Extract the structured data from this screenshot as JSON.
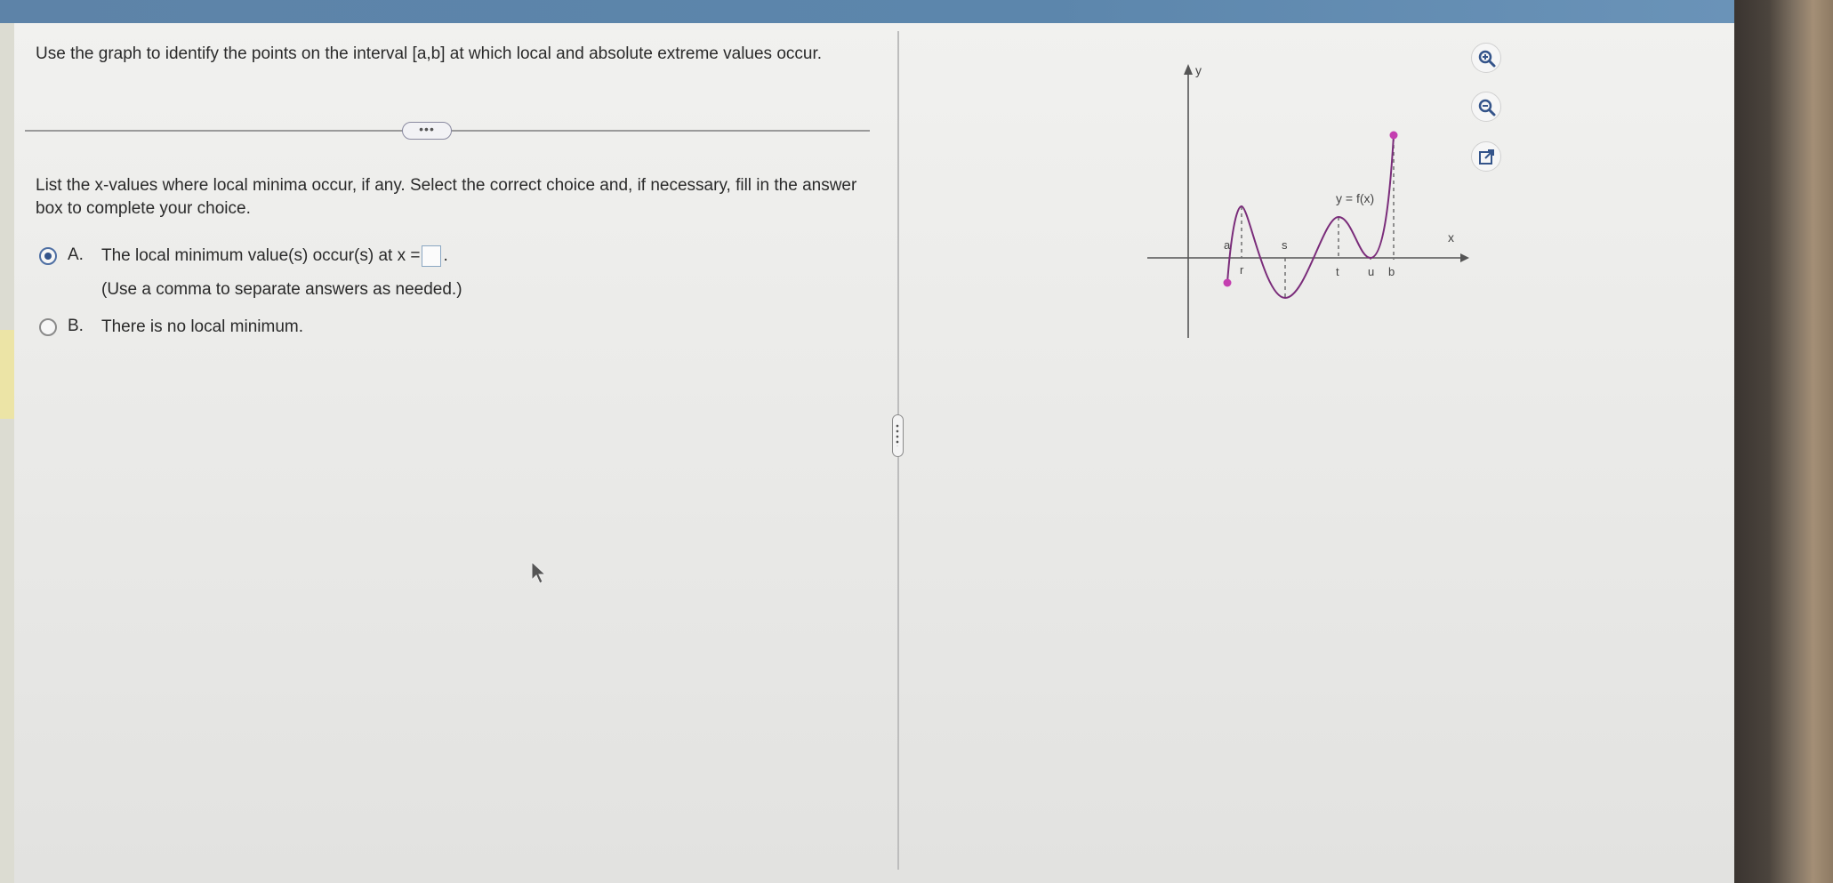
{
  "question": {
    "text": "Use the graph to identify the points on the interval [a,b] at which local and absolute extreme values occur.",
    "more_button": "•••"
  },
  "prompt": "List the x-values where local minima occur, if any. Select the correct choice and, if necessary, fill in the answer box to complete your choice.",
  "choices": [
    {
      "letter": "A.",
      "text_before": "The local minimum value(s) occur(s) at x =",
      "text_after": ".",
      "hint": "(Use a comma to separate answers as needed.)",
      "selected": true,
      "answer_value": ""
    },
    {
      "letter": "B.",
      "text": "There is no local minimum.",
      "selected": false
    }
  ],
  "graph": {
    "curve_label": "y = f(x)",
    "y_axis_label": "y",
    "x_axis_label": "x",
    "x_points": [
      "a",
      "r",
      "s",
      "t",
      "u",
      "b"
    ],
    "curve_color": "#7a2c7a",
    "endpoint_color": "#c43fb0"
  },
  "toolbar": {
    "zoom_in": "zoom-in-icon",
    "zoom_out": "zoom-out-icon",
    "popout": "external-link-icon"
  },
  "colors": {
    "accent": "#34548a",
    "top_bar": "#5d83a8"
  }
}
